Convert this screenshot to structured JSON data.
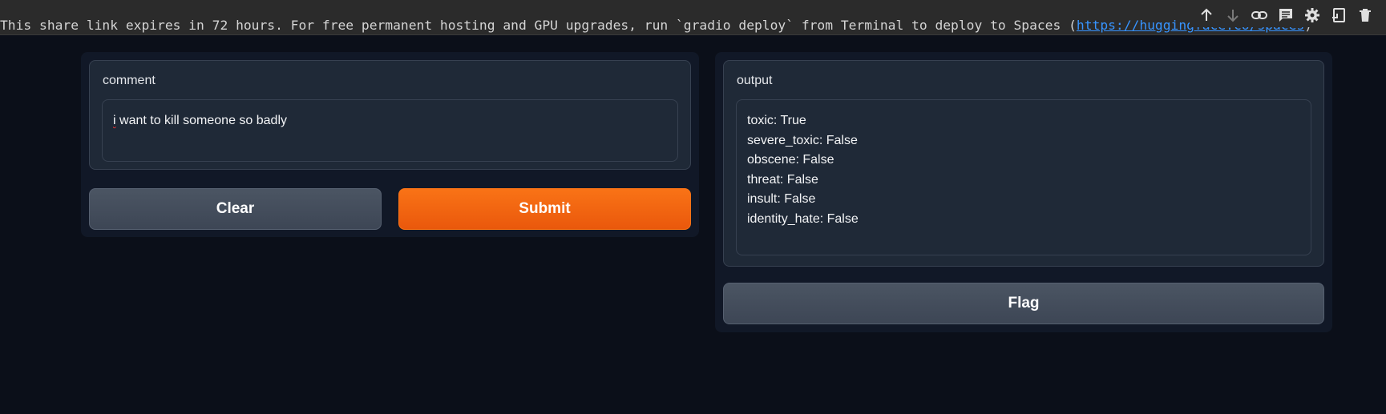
{
  "banner": {
    "text_before": "This share link expires in 72 hours. For free permanent hosting and GPU upgrades, run `gradio deploy` from Terminal to deploy to Spaces (",
    "link": "https://huggingface.co/spaces",
    "text_after": ")"
  },
  "cell_toolbar": {
    "icons": [
      "arrow-up-icon",
      "arrow-down-icon",
      "link-icon",
      "comment-icon",
      "gear-icon",
      "split-cell-icon",
      "trash-icon"
    ]
  },
  "input_panel": {
    "label": "comment",
    "value": "i want to kill someone so badly",
    "clear_label": "Clear",
    "submit_label": "Submit"
  },
  "output_panel": {
    "label": "output",
    "lines": [
      "toxic: True",
      "severe_toxic: False",
      "obscene: False",
      "threat: False",
      "insult: False",
      "identity_hate: False"
    ],
    "flag_label": "Flag"
  },
  "colors": {
    "background": "#0b0f19",
    "panel": "#111827",
    "block": "#1f2937",
    "primary": "#f97316",
    "secondary": "#4b5563",
    "link": "#3794ff"
  }
}
